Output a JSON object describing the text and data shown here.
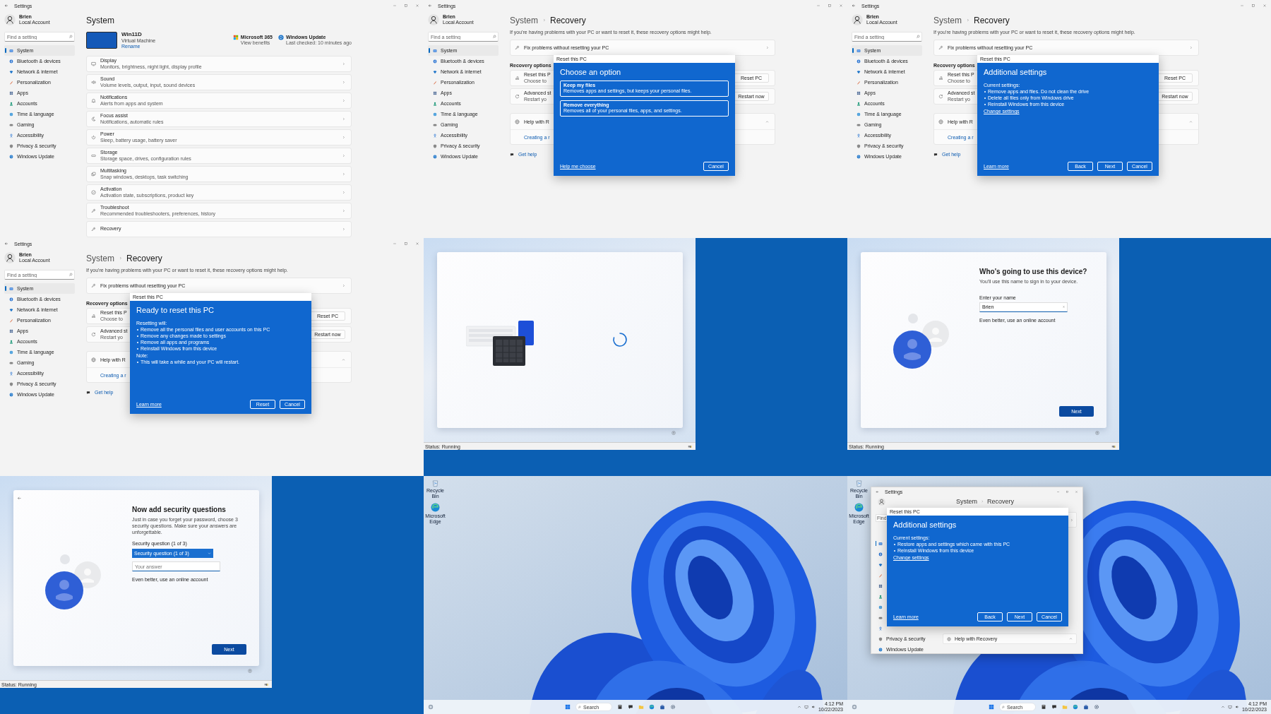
{
  "frames": [
    {
      "kind": "settings",
      "window_title": "Settings",
      "user_name": "Brien",
      "user_account": "Local Account",
      "search_placeholder": "Find a setting",
      "nav": [
        {
          "label": "System",
          "selected": true
        },
        {
          "label": "Bluetooth & devices",
          "selected": false
        },
        {
          "label": "Network & internet",
          "selected": false
        },
        {
          "label": "Personalization",
          "selected": false
        },
        {
          "label": "Apps",
          "selected": false
        },
        {
          "label": "Accounts",
          "selected": false
        },
        {
          "label": "Time & language",
          "selected": false
        },
        {
          "label": "Gaming",
          "selected": false
        },
        {
          "label": "Accessibility",
          "selected": false
        },
        {
          "label": "Privacy & security",
          "selected": false
        },
        {
          "label": "Windows Update",
          "selected": false
        }
      ],
      "page": {
        "kind": "system",
        "title": "System",
        "device_name": "Win11D",
        "device_type": "Virtual Machine",
        "device_link": "Rename",
        "tiles": [
          {
            "kind": "office",
            "title": "Microsoft 365",
            "subtitle": "View benefits"
          },
          {
            "kind": "update",
            "title": "Windows Update",
            "subtitle": "Last checked: 10 minutes ago"
          }
        ],
        "rows": [
          {
            "title": "Display",
            "subtitle": "Monitors, brightness, night light, display profile"
          },
          {
            "title": "Sound",
            "subtitle": "Volume levels, output, input, sound devices"
          },
          {
            "title": "Notifications",
            "subtitle": "Alerts from apps and system"
          },
          {
            "title": "Focus assist",
            "subtitle": "Notifications, automatic rules"
          },
          {
            "title": "Power",
            "subtitle": "Sleep, battery usage, battery saver"
          },
          {
            "title": "Storage",
            "subtitle": "Storage space, drives, configuration rules"
          },
          {
            "title": "Multitasking",
            "subtitle": "Snap windows, desktops, task switching"
          },
          {
            "title": "Activation",
            "subtitle": "Activation state, subscriptions, product key"
          },
          {
            "title": "Troubleshoot",
            "subtitle": "Recommended troubleshooters, preferences, history"
          },
          {
            "title": "Recovery"
          }
        ]
      }
    },
    {
      "kind": "settings",
      "window_title": "Settings",
      "user_name": "Brien",
      "user_account": "Local Account",
      "search_placeholder": "Find a setting",
      "nav": [
        {
          "label": "System",
          "selected": true
        },
        {
          "label": "Bluetooth & devices",
          "selected": false
        },
        {
          "label": "Network & internet",
          "selected": false
        },
        {
          "label": "Personalization",
          "selected": false
        },
        {
          "label": "Apps",
          "selected": false
        },
        {
          "label": "Accounts",
          "selected": false
        },
        {
          "label": "Time & language",
          "selected": false
        },
        {
          "label": "Gaming",
          "selected": false
        },
        {
          "label": "Accessibility",
          "selected": false
        },
        {
          "label": "Privacy & security",
          "selected": false
        },
        {
          "label": "Windows Update",
          "selected": false
        }
      ],
      "page": {
        "kind": "recovery",
        "crumb": "System",
        "title": "Recovery",
        "description": "If you're having problems with your PC or want to reset it, these recovery options might help.",
        "fix_title": "Fix problems without resetting your PC",
        "section": "Recovery options",
        "options": [
          {
            "title": "Reset this P",
            "subtitle": "Choose to",
            "button": "Reset PC"
          },
          {
            "title": "Advanced st",
            "subtitle": "Restart yo",
            "button": "Restart now"
          }
        ],
        "help_title": "Help with R",
        "help_item": "Creating a r",
        "get_help": "Get help"
      },
      "dialog": {
        "window_title": "Reset this PC",
        "title": "Choose an option",
        "blocks": [
          {
            "kind": "choice",
            "title": "Keep my files",
            "text": "Removes apps and settings, but keeps your personal files."
          },
          {
            "kind": "choice",
            "title": "Remove everything",
            "text": "Removes all of your personal files, apps, and settings."
          }
        ],
        "footer_link": "Help me choose",
        "buttons": [
          "Cancel"
        ]
      }
    },
    {
      "kind": "settings",
      "window_title": "Settings",
      "user_name": "Brien",
      "user_account": "Local Account",
      "search_placeholder": "Find a setting",
      "nav": [
        {
          "label": "System",
          "selected": true
        },
        {
          "label": "Bluetooth & devices",
          "selected": false
        },
        {
          "label": "Network & internet",
          "selected": false
        },
        {
          "label": "Personalization",
          "selected": false
        },
        {
          "label": "Apps",
          "selected": false
        },
        {
          "label": "Accounts",
          "selected": false
        },
        {
          "label": "Time & language",
          "selected": false
        },
        {
          "label": "Gaming",
          "selected": false
        },
        {
          "label": "Accessibility",
          "selected": false
        },
        {
          "label": "Privacy & security",
          "selected": false
        },
        {
          "label": "Windows Update",
          "selected": false
        }
      ],
      "page": {
        "kind": "recovery",
        "crumb": "System",
        "title": "Recovery",
        "description": "If you're having problems with your PC or want to reset it, these recovery options might help.",
        "fix_title": "Fix problems without resetting your PC",
        "section": "Recovery options",
        "options": [
          {
            "title": "Reset this P",
            "subtitle": "Choose to",
            "button": "Reset PC"
          },
          {
            "title": "Advanced st",
            "subtitle": "Restart yo",
            "button": "Restart now"
          }
        ],
        "help_title": "Help with R",
        "help_item": "Creating a r",
        "get_help": "Get help"
      },
      "dialog": {
        "window_title": "Reset this PC",
        "title": "Additional settings",
        "blocks": [
          {
            "kind": "heading",
            "text": "Current settings:"
          },
          {
            "kind": "bullet",
            "text": "Remove apps and files. Do not clean the drive"
          },
          {
            "kind": "bullet",
            "text": "Delete all files only from Windows drive"
          },
          {
            "kind": "bullet",
            "text": "Reinstall Windows from this device"
          },
          {
            "kind": "link",
            "text": "Change settings"
          }
        ],
        "footer_link": "Learn more",
        "buttons": [
          "Back",
          "Next",
          "Cancel"
        ]
      }
    },
    {
      "kind": "settings",
      "window_title": "Settings",
      "user_name": "Brien",
      "user_account": "Local Account",
      "search_placeholder": "Find a setting",
      "nav": [
        {
          "label": "System",
          "selected": true
        },
        {
          "label": "Bluetooth & devices",
          "selected": false
        },
        {
          "label": "Network & internet",
          "selected": false
        },
        {
          "label": "Personalization",
          "selected": false
        },
        {
          "label": "Apps",
          "selected": false
        },
        {
          "label": "Accounts",
          "selected": false
        },
        {
          "label": "Time & language",
          "selected": false
        },
        {
          "label": "Gaming",
          "selected": false
        },
        {
          "label": "Accessibility",
          "selected": false
        },
        {
          "label": "Privacy & security",
          "selected": false
        },
        {
          "label": "Windows Update",
          "selected": false
        }
      ],
      "page": {
        "kind": "recovery",
        "crumb": "System",
        "title": "Recovery",
        "description": "If you're having problems with your PC or want to reset it, these recovery options might help.",
        "fix_title": "Fix problems without resetting your PC",
        "section": "Recovery options",
        "options": [
          {
            "title": "Reset this P",
            "subtitle": "Choose to",
            "button": "Reset PC"
          },
          {
            "title": "Advanced st",
            "subtitle": "Restart yo",
            "button": "Restart now"
          }
        ],
        "help_title": "Help with R",
        "help_item": "Creating a r",
        "get_help": "Get help"
      },
      "dialog": {
        "window_title": "Reset this PC",
        "title": "Ready to reset this PC",
        "blocks": [
          {
            "kind": "heading",
            "text": "Resetting will:"
          },
          {
            "kind": "bullet",
            "text": "Remove all the personal files and user accounts on this PC"
          },
          {
            "kind": "bullet",
            "text": "Remove any changes made to settings"
          },
          {
            "kind": "bullet",
            "text": "Remove all apps and programs"
          },
          {
            "kind": "bullet",
            "text": "Reinstall Windows from this device"
          },
          {
            "kind": "heading",
            "text": "Note:"
          },
          {
            "kind": "bullet",
            "text": "This will take a while and your PC will restart."
          }
        ],
        "footer_link": "Learn more",
        "buttons": [
          "Reset",
          "Cancel"
        ]
      }
    },
    {
      "kind": "vm",
      "status": "Status: Running",
      "screen": {
        "kind": "loading"
      }
    },
    {
      "kind": "vm",
      "status": "Status: Running",
      "screen": {
        "kind": "name",
        "title": "Who's going to use this device?",
        "subtitle": "You'll use this name to sign in to your device.",
        "field_label": "Enter your name",
        "field_value": "Brien",
        "link": "Even better, use an online account",
        "button": "Next"
      }
    },
    {
      "kind": "vm",
      "status": "Status: Running",
      "screen": {
        "kind": "security",
        "title": "Now add security questions",
        "subtitle": "Just in case you forget your password, choose 3 security questions. Make sure your answers are unforgettable.",
        "field_label": "Security question (1 of 3)",
        "select_value": "Security question (1 of 3)",
        "answer_placeholder": "Your answer",
        "link": "Even better, use an online account",
        "button": "Next"
      }
    },
    {
      "kind": "desktop",
      "desktop_icons": [
        {
          "kind": "recycle",
          "label": "Recycle Bin"
        },
        {
          "kind": "edge",
          "label": "Microsoft Edge"
        }
      ],
      "taskbar": {
        "search_placeholder": "Search",
        "time": "4:12 PM",
        "date": "10/22/2023"
      }
    },
    {
      "kind": "desktop",
      "desktop_icons": [
        {
          "kind": "recycle",
          "label": "Recycle Bin"
        },
        {
          "kind": "edge",
          "label": "Microsoft Edge"
        }
      ],
      "taskbar": {
        "search_placeholder": "Search",
        "time": "4:12 PM",
        "date": "10/22/2023"
      },
      "window": {
        "window_title": "Settings",
        "search_placeholder": "Find",
        "crumb": "System",
        "title": "Recovery",
        "nav": [
          {
            "selected": true
          },
          {
            "selected": false
          },
          {
            "selected": false
          },
          {
            "selected": false
          },
          {
            "selected": false
          },
          {
            "selected": false
          },
          {
            "selected": false
          },
          {
            "selected": false
          },
          {
            "selected": false
          },
          {
            "label": "Privacy & security",
            "selected": false
          },
          {
            "label": "Windows Update",
            "selected": false
          }
        ],
        "help_title": "Help with Recovery",
        "dialog": {
          "window_title": "Reset this PC",
          "title": "Additional settings",
          "blocks": [
            {
              "kind": "heading",
              "text": "Current settings:"
            },
            {
              "kind": "bullet",
              "text": "Restore apps and settings which came with this PC"
            },
            {
              "kind": "bullet",
              "text": "Reinstall Windows from this device"
            },
            {
              "kind": "link",
              "text": "Change settings"
            }
          ],
          "footer_link": "Learn more",
          "buttons": [
            "Back",
            "Next",
            "Cancel"
          ]
        }
      }
    }
  ]
}
